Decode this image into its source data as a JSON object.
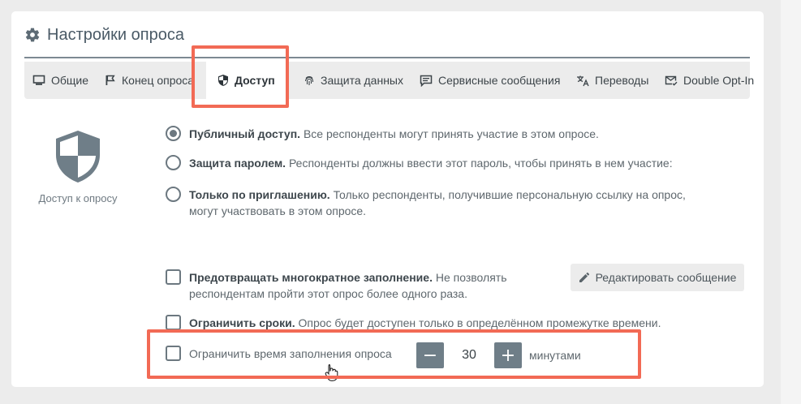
{
  "card": {
    "title": "Настройки опроса",
    "header_icon": "gear-icon"
  },
  "tabs": [
    {
      "label": "Общие",
      "icon": "monitor-icon",
      "active": false
    },
    {
      "label": "Конец опроса",
      "icon": "flag-icon",
      "active": false
    },
    {
      "label": "Доступ",
      "icon": "shield-icon",
      "active": true
    },
    {
      "label": "Защита данных",
      "icon": "fingerprint-icon",
      "active": false
    },
    {
      "label": "Сервисные сообщения",
      "icon": "message-icon",
      "active": false
    },
    {
      "label": "Переводы",
      "icon": "translate-icon",
      "active": false
    },
    {
      "label": "Double Opt-In",
      "icon": "mail-check-icon",
      "active": false
    }
  ],
  "access": {
    "caption": "Доступ к опросу",
    "options": [
      {
        "title": "Публичный доступ.",
        "desc": "Все респонденты могут принять участие в этом опросе.",
        "checked": true
      },
      {
        "title": "Защита паролем.",
        "desc": "Респонденты должны ввести этот пароль, чтобы принять в нем участие:",
        "checked": false
      },
      {
        "title": "Только по приглашению.",
        "desc": "Только респонденты, получившие персональную ссылку на опрос, могут участвовать в этом опросе.",
        "checked": false
      }
    ]
  },
  "restrictions": {
    "prevent_multiple": {
      "title": "Предотвращать многократное заполнение.",
      "desc": "Не позволять респондентам пройти этот опрос более одного раза.",
      "checked": false
    },
    "edit_message_label": "Редактировать сообщение",
    "limit_dates": {
      "title": "Ограничить сроки.",
      "desc": "Опрос будет доступен только в определённом промежутке времени.",
      "checked": false
    },
    "limit_time": {
      "label": "Ограничить время заполнения опроса",
      "checked": false,
      "value": "30",
      "unit": "минутами",
      "minus": "−",
      "plus": "+"
    }
  },
  "colors": {
    "highlight": "#f26a55",
    "accent": "#6f7e88",
    "tab_bar": "#ececec"
  }
}
